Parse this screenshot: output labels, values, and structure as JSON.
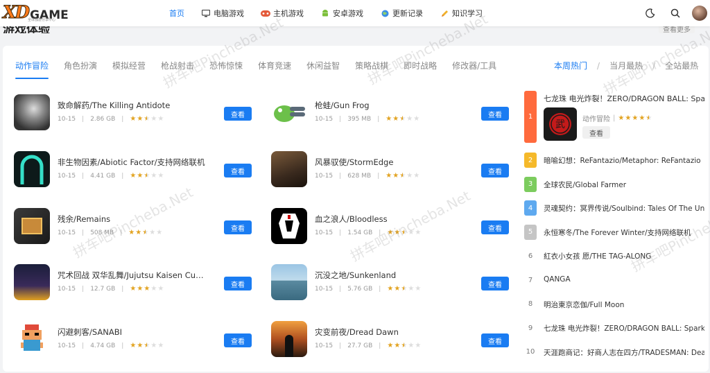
{
  "header": {
    "logo_main": "XD",
    "logo_game": "GAME",
    "logo_sub": "全球独游分享中心",
    "nav": [
      {
        "label": "首页",
        "icon": "",
        "active": true
      },
      {
        "label": "电脑游戏",
        "icon": "monitor-icon",
        "active": false
      },
      {
        "label": "主机游戏",
        "icon": "gamepad-icon",
        "active": false
      },
      {
        "label": "安卓游戏",
        "icon": "android-icon",
        "active": false
      },
      {
        "label": "更新记录",
        "icon": "globe-icon",
        "active": false
      },
      {
        "label": "知识学习",
        "icon": "pencil-icon",
        "active": false
      }
    ]
  },
  "partial": {
    "title": "游戏体验",
    "more": "查看更多"
  },
  "tabs": [
    "动作冒险",
    "角色扮演",
    "模拟经营",
    "枪战射击",
    "恐怖惊悚",
    "体育竞速",
    "休闲益智",
    "策略战棋",
    "即时战略",
    "修改器/工具"
  ],
  "rank_tabs": [
    "本周热门",
    "当月最热",
    "全站最热"
  ],
  "games": [
    {
      "title": "致命解药/The Killing Antidote",
      "date": "10-15",
      "size": "2.86 GB",
      "rating": 2.5,
      "btn": "查看"
    },
    {
      "title": "枪蛙/Gun Frog",
      "date": "10-15",
      "size": "395 MB",
      "rating": 2.5,
      "btn": "查看"
    },
    {
      "title": "非生物因素/Abiotic Factor/支持网络联机",
      "date": "10-15",
      "size": "4.41 GB",
      "rating": 2.5,
      "btn": "查看"
    },
    {
      "title": "风暴驭使/StormEdge",
      "date": "10-15",
      "size": "628 MB",
      "rating": 2.5,
      "btn": "查看"
    },
    {
      "title": "残余/Remains",
      "date": "10-15",
      "size": "508 MB",
      "rating": 2.5,
      "btn": "查看"
    },
    {
      "title": "血之浪人/Bloodless",
      "date": "10-15",
      "size": "1.54 GB",
      "rating": 2.5,
      "btn": "查看"
    },
    {
      "title": "咒术回战 双华乱舞/Jujutsu Kaisen Cursed Clash",
      "date": "10-15",
      "size": "12.7 GB",
      "rating": 3,
      "btn": "查看"
    },
    {
      "title": "沉没之地/Sunkenland",
      "date": "10-15",
      "size": "5.76 GB",
      "rating": 2.5,
      "btn": "查看"
    },
    {
      "title": "闪避刺客/SANABI",
      "date": "10-15",
      "size": "4.74 GB",
      "rating": 2.5,
      "btn": "查看"
    },
    {
      "title": "灾变前夜/Dread Dawn",
      "date": "10-15",
      "size": "27.7 GB",
      "rating": 2.5,
      "btn": "查看"
    }
  ],
  "rank_first": {
    "num": "1",
    "title": "七龙珠 电光炸裂！ZERO/DRAGON BALL: Sparking! ZERO",
    "category": "动作冒险",
    "rating": 4.5,
    "btn": "查看"
  },
  "rank_list": [
    {
      "num": "2",
      "name": "暗喻幻想：ReFantazio/Metaphor: ReFantazio"
    },
    {
      "num": "3",
      "name": "全球农民/Global Farmer"
    },
    {
      "num": "4",
      "name": "灵魂契约：冥界传说/Soulbind: Tales Of The Underworld"
    },
    {
      "num": "5",
      "name": "永恒寒冬/The Forever Winter/支持网络联机"
    },
    {
      "num": "6",
      "name": "紅衣小女孩 愿/THE TAG-ALONG"
    },
    {
      "num": "7",
      "name": "QANGA"
    },
    {
      "num": "8",
      "name": "明治東京恋伽/Full Moon"
    },
    {
      "num": "9",
      "name": "七龙珠 电光炸裂！ZERO/DRAGON BALL: Sparking! ZERO"
    },
    {
      "num": "10",
      "name": "天涯跑商记：好商人志在四方/TRADESMAN: Deal to Dealer"
    }
  ],
  "watermark": "拼车吧Pincheba.Net"
}
